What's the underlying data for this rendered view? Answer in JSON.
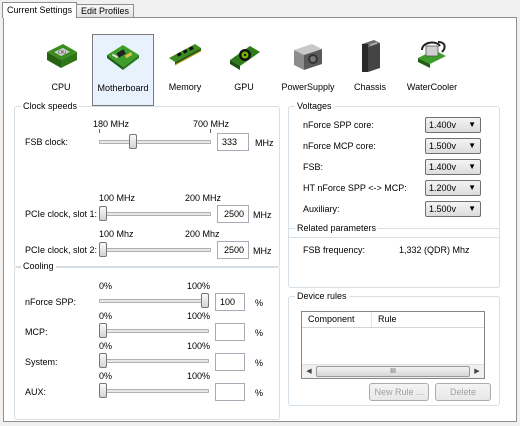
{
  "tabs": [
    {
      "label": "Current Settings",
      "active": true
    },
    {
      "label": "Edit Profiles",
      "active": false
    }
  ],
  "categories": [
    {
      "label": "CPU",
      "icon": "cpu-icon"
    },
    {
      "label": "Motherboard",
      "icon": "motherboard-icon",
      "selected": true
    },
    {
      "label": "Memory",
      "icon": "memory-icon"
    },
    {
      "label": "GPU",
      "icon": "gpu-icon"
    },
    {
      "label": "PowerSupply",
      "icon": "power-supply-icon"
    },
    {
      "label": "Chassis",
      "icon": "chassis-icon"
    },
    {
      "label": "WaterCooler",
      "icon": "water-cooler-icon"
    }
  ],
  "clock": {
    "title": "Clock speeds",
    "fsb": {
      "label": "FSB clock:",
      "min_label": "180 MHz",
      "max_label": "700 MHz",
      "value": "333",
      "unit": "MHz"
    },
    "pcie1": {
      "label": "PCIe clock, slot 1:",
      "min_label": "100 MHz",
      "max_label": "200 MHz",
      "value": "2500",
      "unit": "MHz"
    },
    "pcie2": {
      "label": "PCIe clock, slot 2:",
      "min_label": "100 Mhz",
      "max_label": "200 Mhz",
      "value": "2500",
      "unit": "MHz"
    }
  },
  "cooling": {
    "title": "Cooling",
    "rows": [
      {
        "label": "nForce SPP:",
        "min_label": "0%",
        "max_label": "100%",
        "value": "100",
        "unit": "%",
        "level": 1.0
      },
      {
        "label": "MCP:",
        "min_label": "0%",
        "max_label": "100%",
        "value": "",
        "unit": "%",
        "level": 0.0
      },
      {
        "label": "System:",
        "min_label": "0%",
        "max_label": "100%",
        "value": "",
        "unit": "%",
        "level": 0.0
      },
      {
        "label": "AUX:",
        "min_label": "0%",
        "max_label": "100%",
        "value": "",
        "unit": "%",
        "level": 0.0
      }
    ]
  },
  "voltages": {
    "title": "Voltages",
    "rows": [
      {
        "label": "nForce SPP core:",
        "value": "1.400v"
      },
      {
        "label": "nForce MCP core:",
        "value": "1.500v"
      },
      {
        "label": "FSB:",
        "value": "1.400v"
      },
      {
        "label": "HT nForce SPP <-> MCP:",
        "value": "1.200v"
      },
      {
        "label": "Auxiliary:",
        "value": "1.500v"
      }
    ]
  },
  "related": {
    "title": "Related parameters",
    "fsb_freq_label": "FSB frequency:",
    "fsb_freq_value": "1,332 (QDR) Mhz"
  },
  "device_rules": {
    "title": "Device rules",
    "columns": [
      "Component",
      "Rule"
    ],
    "new_rule_label": "New Rule ...",
    "delete_label": "Delete",
    "scroll_grip": "III"
  }
}
